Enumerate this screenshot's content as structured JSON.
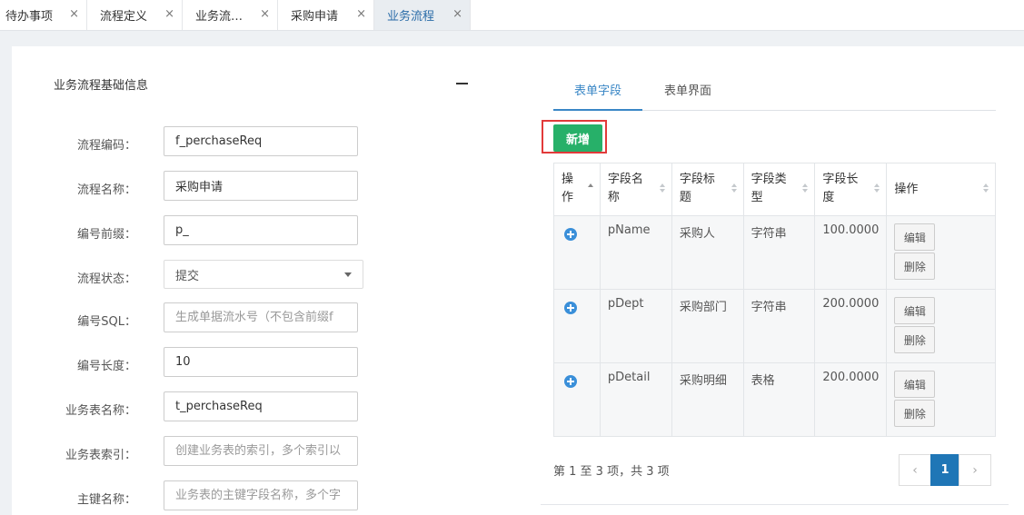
{
  "tabs": [
    {
      "label": "待办事项",
      "close": "×"
    },
    {
      "label": "流程定义",
      "close": "×"
    },
    {
      "label": "业务流…",
      "close": "×"
    },
    {
      "label": "采购申请",
      "close": "×"
    },
    {
      "label": "业务流程",
      "close": "×"
    }
  ],
  "left": {
    "title": "业务流程基础信息",
    "fields": [
      {
        "label": "流程编码：",
        "value": "f_perchaseReq",
        "placeholder": ""
      },
      {
        "label": "流程名称：",
        "value": "采购申请",
        "placeholder": ""
      },
      {
        "label": "编号前缀：",
        "value": "p_",
        "placeholder": ""
      },
      {
        "label": "流程状态：",
        "value": "提交",
        "placeholder": ""
      },
      {
        "label": "编号SQL：",
        "value": "",
        "placeholder": "生成单据流水号（不包含前缀f"
      },
      {
        "label": "编号长度：",
        "value": "10",
        "placeholder": ""
      },
      {
        "label": "业务表名称：",
        "value": "t_perchaseReq",
        "placeholder": ""
      },
      {
        "label": "业务表索引：",
        "value": "",
        "placeholder": "创建业务表的索引，多个索引以"
      },
      {
        "label": "主键名称：",
        "value": "",
        "placeholder": "业务表的主键字段名称，多个字"
      }
    ]
  },
  "right": {
    "tabs": [
      "表单字段",
      "表单界面"
    ],
    "add_label": "新增",
    "columns": [
      {
        "l1": "操",
        "l2": "作"
      },
      {
        "l1": "字段名",
        "l2": "称"
      },
      {
        "l1": "字段标",
        "l2": "题"
      },
      {
        "l1": "字段类",
        "l2": "型"
      },
      {
        "l1": "字段长",
        "l2": "度"
      },
      {
        "l1": "操作",
        "l2": ""
      }
    ],
    "rows": [
      {
        "name": "pName",
        "title": "采购人",
        "type": "字符串",
        "length": "100.0000"
      },
      {
        "name": "pDept",
        "title": "采购部门",
        "type": "字符串",
        "length": "200.0000"
      },
      {
        "name": "pDetail",
        "title": "采购明细",
        "type": "表格",
        "length": "200.0000"
      }
    ],
    "edit_label": "编辑",
    "delete_label": "删除",
    "page_info": "第 1 至 3 项，共 3 项",
    "pager": {
      "prev": "‹",
      "current": "1",
      "next": "›"
    }
  },
  "colors": {
    "accent": "#3a87c6",
    "add_button": "#27b069",
    "highlight": "#e23a3a",
    "pager_active": "#1f76b6"
  }
}
